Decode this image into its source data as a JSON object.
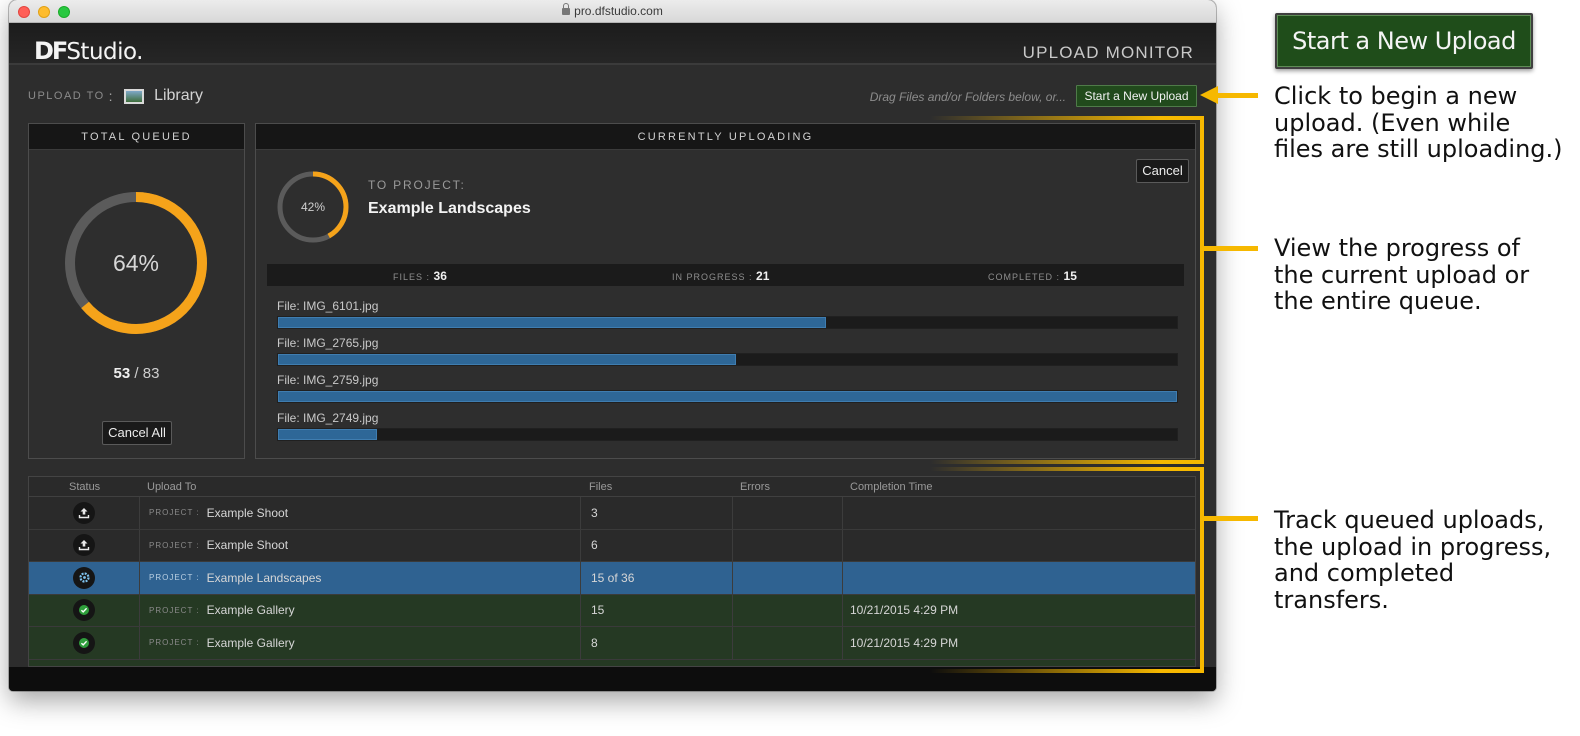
{
  "browser": {
    "url": "pro.dfstudio.com"
  },
  "app": {
    "logo_mark": "DF",
    "logo_word": "Studio.",
    "title": "UPLOAD MONITOR"
  },
  "toolbar": {
    "upload_to_label": "UPLOAD TO",
    "upload_to_colon": ":",
    "destination": "Library",
    "drag_hint": "Drag Files and/or Folders below, or...",
    "new_upload_label": "Start a New Upload"
  },
  "total_queued": {
    "header": "TOTAL QUEUED",
    "percent_label": "64%",
    "percent": 0.64,
    "completed": "53",
    "separator": "/",
    "total": "83",
    "cancel_all_label": "Cancel All"
  },
  "current": {
    "header": "CURRENTLY UPLOADING",
    "cancel_label": "Cancel",
    "percent_label": "42%",
    "percent": 0.42,
    "to_project_label": "TO PROJECT:",
    "project_name": "Example Landscapes",
    "stats": {
      "files_label": "FILES :",
      "files_value": "36",
      "in_progress_label": "IN PROGRESS :",
      "in_progress_value": "21",
      "completed_label": "COMPLETED :",
      "completed_value": "15"
    },
    "files": [
      {
        "label": "File: IMG_6101.jpg",
        "progress": 0.61
      },
      {
        "label": "File: IMG_2765.jpg",
        "progress": 0.51
      },
      {
        "label": "File: IMG_2759.jpg",
        "progress": 1.0
      },
      {
        "label": "File: IMG_2749.jpg",
        "progress": 0.11
      }
    ]
  },
  "queue": {
    "columns": [
      "Status",
      "Upload To",
      "Files",
      "Errors",
      "Completion Time"
    ],
    "rows": [
      {
        "status": "upload-icon",
        "tag": "PROJECT :",
        "name": "Example Shoot",
        "files": "3",
        "errors": "",
        "time": "",
        "state": "queued"
      },
      {
        "status": "upload-icon",
        "tag": "PROJECT :",
        "name": "Example Shoot",
        "files": "6",
        "errors": "",
        "time": "",
        "state": "queued"
      },
      {
        "status": "gear-icon",
        "tag": "PROJECT :",
        "name": "Example Landscapes",
        "files": "15 of 36",
        "errors": "",
        "time": "",
        "state": "active"
      },
      {
        "status": "checkmark-icon",
        "tag": "PROJECT :",
        "name": "Example Gallery",
        "files": "15",
        "errors": "",
        "time": "10/21/2015 4:29 PM",
        "state": "done"
      },
      {
        "status": "checkmark-icon",
        "tag": "PROJECT :",
        "name": "Example Gallery",
        "files": "8",
        "errors": "",
        "time": "10/21/2015 4:29 PM",
        "state": "done"
      }
    ]
  },
  "annotations": {
    "big_button_label": "Start a New Upload",
    "note1": [
      "Click to begin a new",
      "upload. (Even while",
      "files are still uploading.)"
    ],
    "note2": [
      "View the progress of",
      "the current upload or",
      "the entire queue."
    ],
    "note3": [
      "Track queued uploads,",
      "the upload in progress,",
      "and completed",
      "transfers."
    ]
  },
  "colors": {
    "accent_orange": "#f5a31a",
    "highlight_yellow": "#f6b800",
    "progress_blue": "#2e6797",
    "success_green": "#2f9e3c",
    "button_green": "#1f4d1a"
  }
}
